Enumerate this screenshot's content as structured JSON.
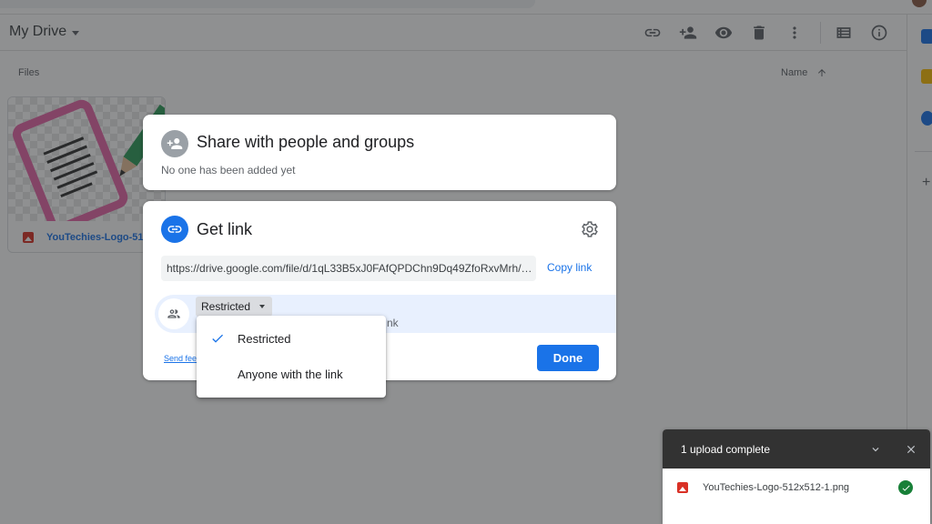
{
  "drive": {
    "title": "My Drive",
    "files_label": "Files",
    "sort_label": "Name",
    "file_name": "YouTechies-Logo-512x512-1.png",
    "file_name_short": "YouTechies-Logo-512"
  },
  "toolbar": {
    "icons": [
      "link-icon",
      "add-person-icon",
      "eye-icon",
      "trash-icon",
      "more-vert-icon",
      "list-view-icon",
      "info-icon"
    ]
  },
  "share": {
    "title": "Share with people and groups",
    "subtitle": "No one has been added yet"
  },
  "get_link": {
    "title": "Get link",
    "url": "https://drive.google.com/file/d/1qL33B5xJ0FAfQPDChn9Dq49ZfoRxvMrh/vi...",
    "copy_label": "Copy link",
    "access_value": "Restricted",
    "access_desc_partial": "nk",
    "send_feedback": "Send fee",
    "done_label": "Done"
  },
  "access_menu": {
    "options": [
      "Restricted",
      "Anyone with the link"
    ],
    "selected": "Restricted"
  },
  "upload": {
    "status": "1 upload complete",
    "file": "YouTechies-Logo-512x512-1.png"
  },
  "colors": {
    "accent": "#1a73e8",
    "success": "#188038",
    "toast_bg": "#323232"
  }
}
